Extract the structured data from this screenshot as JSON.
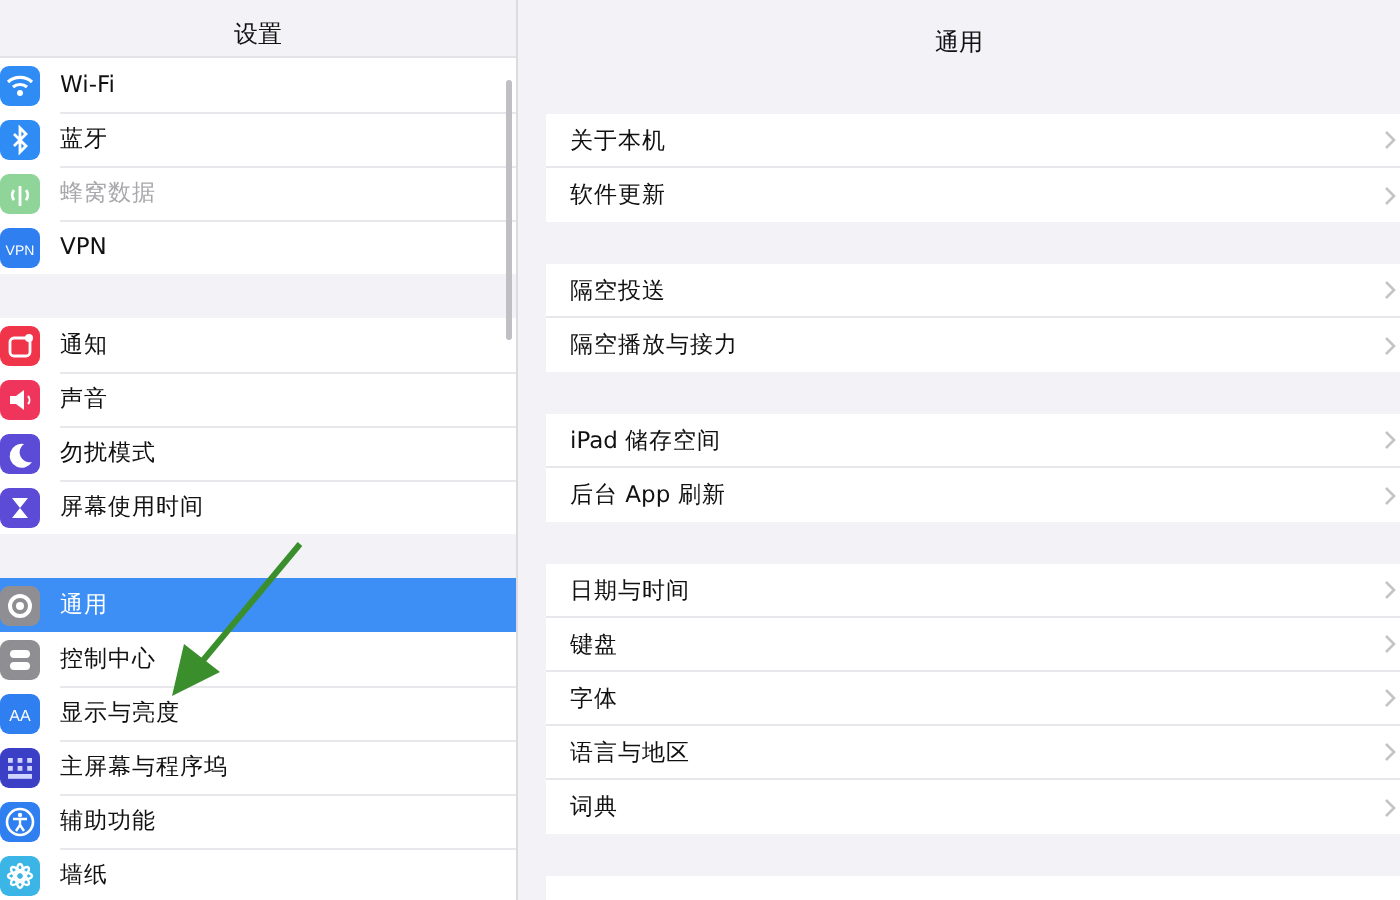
{
  "sidebar": {
    "title": "设置",
    "groups": [
      {
        "items": [
          {
            "label": "Wi-Fi",
            "selected": false,
            "disabled": false
          },
          {
            "label": "蓝牙",
            "selected": false,
            "disabled": false
          },
          {
            "label": "蜂窝数据",
            "selected": false,
            "disabled": true
          },
          {
            "label": "VPN",
            "icon_text": "VPN",
            "selected": false,
            "disabled": false
          }
        ]
      },
      {
        "items": [
          {
            "label": "通知",
            "selected": false,
            "disabled": false
          },
          {
            "label": "声音",
            "selected": false,
            "disabled": false
          },
          {
            "label": "勿扰模式",
            "selected": false,
            "disabled": false
          },
          {
            "label": "屏幕使用时间",
            "selected": false,
            "disabled": false
          }
        ]
      },
      {
        "items": [
          {
            "label": "通用",
            "selected": true,
            "disabled": false
          },
          {
            "label": "控制中心",
            "selected": false,
            "disabled": false
          },
          {
            "label": "显示与亮度",
            "icon_text": "AA",
            "selected": false,
            "disabled": false
          },
          {
            "label": "主屏幕与程序坞",
            "selected": false,
            "disabled": false
          },
          {
            "label": "辅助功能",
            "selected": false,
            "disabled": false
          },
          {
            "label": "墙纸",
            "selected": false,
            "disabled": false
          }
        ]
      }
    ]
  },
  "detail": {
    "title": "通用",
    "groups": [
      {
        "items": [
          "关于本机",
          "软件更新"
        ]
      },
      {
        "items": [
          "隔空投送",
          "隔空播放与接力"
        ]
      },
      {
        "items": [
          "iPad 储存空间",
          "后台 App 刷新"
        ]
      },
      {
        "items": [
          "日期与时间",
          "键盘",
          "字体",
          "语言与地区",
          "词典"
        ]
      }
    ]
  }
}
